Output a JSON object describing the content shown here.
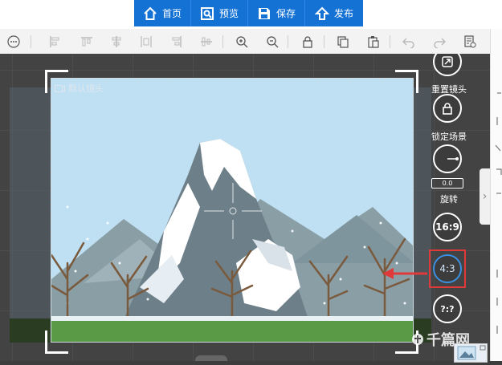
{
  "nav": {
    "items": [
      {
        "label": "首页",
        "icon": "home-icon"
      },
      {
        "label": "预览",
        "icon": "preview-icon"
      },
      {
        "label": "保存",
        "icon": "save-icon"
      },
      {
        "label": "发布",
        "icon": "publish-icon"
      }
    ]
  },
  "stage": {
    "camera_label": "默认镜头"
  },
  "camera_panel": {
    "reset_label": "重置镜头",
    "lock_label": "锁定场景",
    "rotate_value": "0.0",
    "rotate_label": "旋转",
    "ratio_169": "16:9",
    "ratio_43": "4:3",
    "ratio_custom": "?:?"
  },
  "watermark": "千篇网",
  "colors": {
    "nav_blue": "#1572d5",
    "highlight_red": "#e0393a",
    "sky": "#bfe0f3",
    "grass": "#5a9a46"
  }
}
